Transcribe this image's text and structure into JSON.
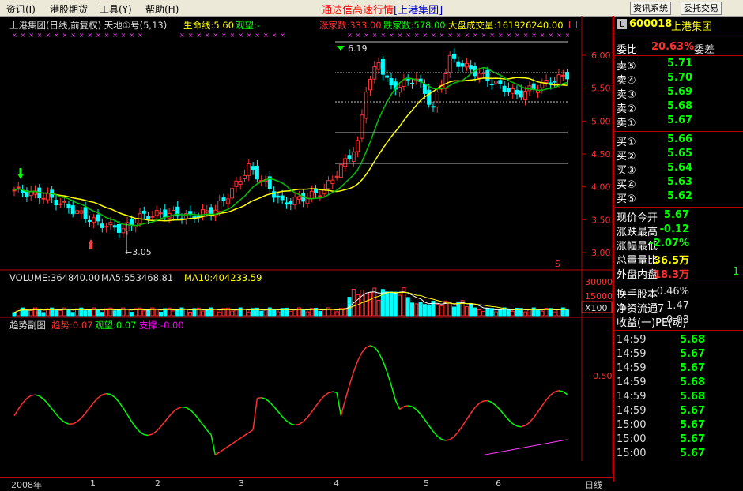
{
  "menu": {
    "items": [
      "资讯(I)",
      "港股期货",
      "工具(Y)",
      "帮助(H)"
    ],
    "title": "通达信高速行情",
    "title_suffix": "[上港集团]",
    "btn_info": "资讯系统",
    "btn_trade": "委托交易"
  },
  "header": {
    "stock_title": "上港集团(日线,前复权)",
    "indicator": "天地①号(5,13)",
    "life_line": "生命线:5.60",
    "watch": "观望:-",
    "up_count": "涨家数:333.00",
    "down_count": "跌家数:578.00",
    "volume_total": "大盘成交量:161926240.00"
  },
  "price_axis": [
    "6.00",
    "5.50",
    "5.00",
    "4.50",
    "4.00",
    "3.50",
    "3.00"
  ],
  "annotations": {
    "high": "6.19",
    "low": "3.05",
    "s_mark": "S"
  },
  "volume_panel": {
    "volume": "VOLUME:364840.00",
    "ma5": "MA5:553468.81",
    "ma10": "MA10:404233.59",
    "axis_top": "30000",
    "axis_mid": "15000",
    "unit": "X100"
  },
  "trend_panel": {
    "title": "趋势副图",
    "trend": "趋势:0.07",
    "watch": "观望:0.07",
    "support": "支撑:-0.00",
    "axis_mid": "0.50"
  },
  "timeline": {
    "year": "2008年",
    "months": [
      "1",
      "2",
      "3",
      "4",
      "5",
      "6"
    ],
    "period": "日线"
  },
  "quote": {
    "code": "600018",
    "name": "上港集团",
    "webi_label": "委比",
    "webi_value": "20.63%",
    "weicha_label": "委差",
    "sells": [
      {
        "label": "卖⑤",
        "price": "5.71"
      },
      {
        "label": "卖④",
        "price": "5.70"
      },
      {
        "label": "卖③",
        "price": "5.69"
      },
      {
        "label": "卖②",
        "price": "5.68"
      },
      {
        "label": "卖①",
        "price": "5.67"
      }
    ],
    "buys": [
      {
        "label": "买①",
        "price": "5.66"
      },
      {
        "label": "买②",
        "price": "5.65"
      },
      {
        "label": "买③",
        "price": "5.64"
      },
      {
        "label": "买④",
        "price": "5.63"
      },
      {
        "label": "买⑤",
        "price": "5.62"
      }
    ],
    "stats": [
      {
        "k": "现价",
        "v": "5.67",
        "k2": "今开",
        "v2": "",
        "c": "#00ff00"
      },
      {
        "k": "涨跌",
        "v": "-0.12",
        "k2": "最高",
        "v2": "",
        "c": "#00ff00"
      },
      {
        "k": "涨幅",
        "v": "-2.07%",
        "k2": "最低",
        "v2": "",
        "c": "#00ff00"
      },
      {
        "k": "总量",
        "v": "36.5万",
        "k2": "量比",
        "v2": "",
        "c": "#ffff00"
      },
      {
        "k": "外盘",
        "v": "18.3万",
        "k2": "内盘",
        "v2": "1",
        "c": "#ff3030"
      }
    ],
    "stats2": [
      {
        "k": "换手",
        "v": "0.46%",
        "k2": "股本",
        "v2": ""
      },
      {
        "k": "净资",
        "v": "1.47",
        "k2": "流通",
        "v2": "7"
      },
      {
        "k": "收益(一)",
        "v": "0.03",
        "k2": "PE(动)",
        "v2": ""
      }
    ],
    "ticks": [
      {
        "t": "14:59",
        "p": "5.68"
      },
      {
        "t": "14:59",
        "p": "5.67"
      },
      {
        "t": "14:59",
        "p": "5.67"
      },
      {
        "t": "14:59",
        "p": "5.68"
      },
      {
        "t": "14:59",
        "p": "5.68"
      },
      {
        "t": "14:59",
        "p": "5.67"
      },
      {
        "t": "15:00",
        "p": "5.67"
      },
      {
        "t": "15:00",
        "p": "5.67"
      },
      {
        "t": "15:00",
        "p": "5.67"
      }
    ]
  },
  "colors": {
    "up": "#ff3030",
    "down": "#00ffff",
    "ma": "#ffff00",
    "green": "#00c000",
    "grid": "#c00000"
  }
}
